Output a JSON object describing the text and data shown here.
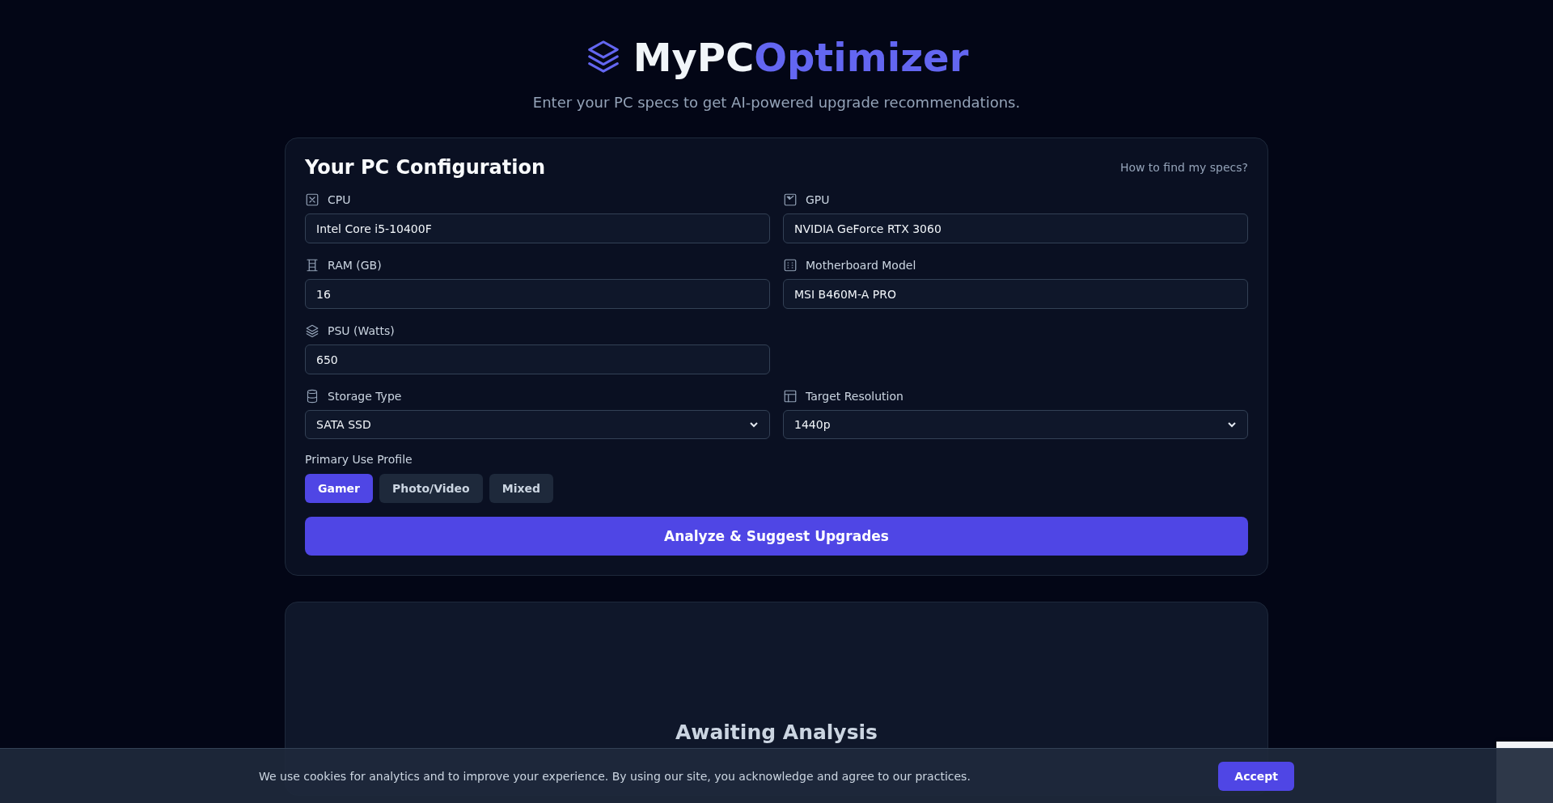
{
  "header": {
    "title_main": "MyPC",
    "title_accent": "Optimizer",
    "subtitle": "Enter your PC specs to get AI-powered upgrade recommendations."
  },
  "config": {
    "title": "Your PC Configuration",
    "help_link": "How to find my specs?",
    "rows": [
      [
        {
          "kind": "input",
          "label": "CPU",
          "value": "Intel Core i5-10400F"
        },
        {
          "kind": "input",
          "label": "GPU",
          "value": "NVIDIA GeForce RTX 3060"
        }
      ],
      [
        {
          "kind": "input",
          "label": "RAM (GB)",
          "value": "16"
        },
        {
          "kind": "input",
          "label": "Motherboard Model",
          "value": "MSI B460M-A PRO"
        }
      ],
      [
        {
          "kind": "input",
          "label": "PSU (Watts)",
          "value": "650"
        }
      ],
      [
        {
          "kind": "select",
          "label": "Storage Type",
          "value": "SATA SSD"
        },
        {
          "kind": "select",
          "label": "Target Resolution",
          "value": "1440p"
        }
      ]
    ],
    "profile": {
      "label": "Primary Use Profile",
      "options": [
        {
          "label": "Gamer",
          "selected": true
        },
        {
          "label": "Photo/Video",
          "selected": false
        },
        {
          "label": "Mixed",
          "selected": false
        }
      ]
    },
    "analyze_button": "Analyze & Suggest Upgrades"
  },
  "results": {
    "title": "Awaiting Analysis"
  },
  "cookie_banner": {
    "text": "We use cookies for analytics and to improve your experience. By using our site, you acknowledge and agree to our practices.",
    "button": "Accept"
  }
}
